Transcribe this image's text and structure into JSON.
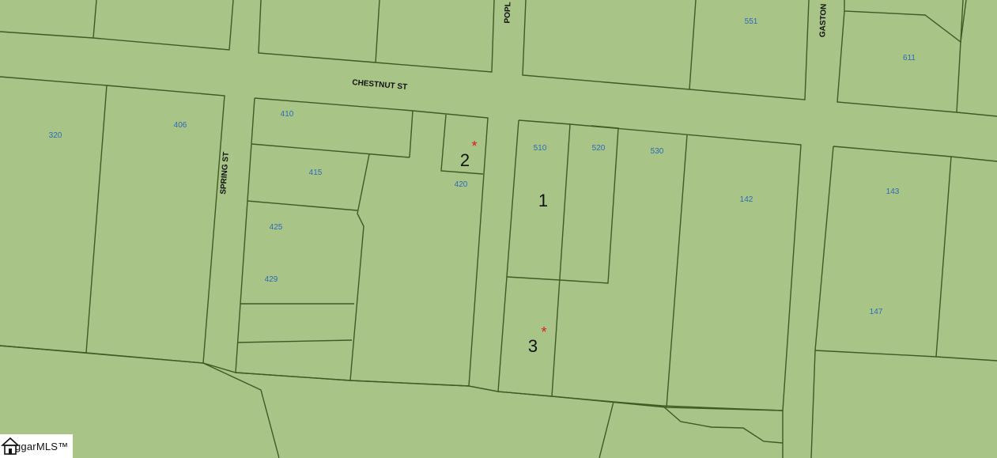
{
  "map": {
    "streets": {
      "chestnut": "CHESTNUT ST",
      "spring": "SPRING ST",
      "poplar": "POPL",
      "gaston": "GASTON"
    },
    "parcels": {
      "p320": "320",
      "p406": "406",
      "p410": "410",
      "p415": "415",
      "p420": "420",
      "p425": "425",
      "p429": "429",
      "p510": "510",
      "p520": "520",
      "p530": "530",
      "p142": "142",
      "p143": "143",
      "p147": "147",
      "p551": "551",
      "p611": "611"
    },
    "markers": {
      "m1": "1",
      "m2": "2",
      "m3": "3",
      "star": "*"
    }
  },
  "logo": {
    "text": "ggarMLS™"
  },
  "colors": {
    "land": "#a9c487",
    "parcel_line": "#3f5a22",
    "address_label": "#2b6cb8",
    "star": "#d62020"
  }
}
